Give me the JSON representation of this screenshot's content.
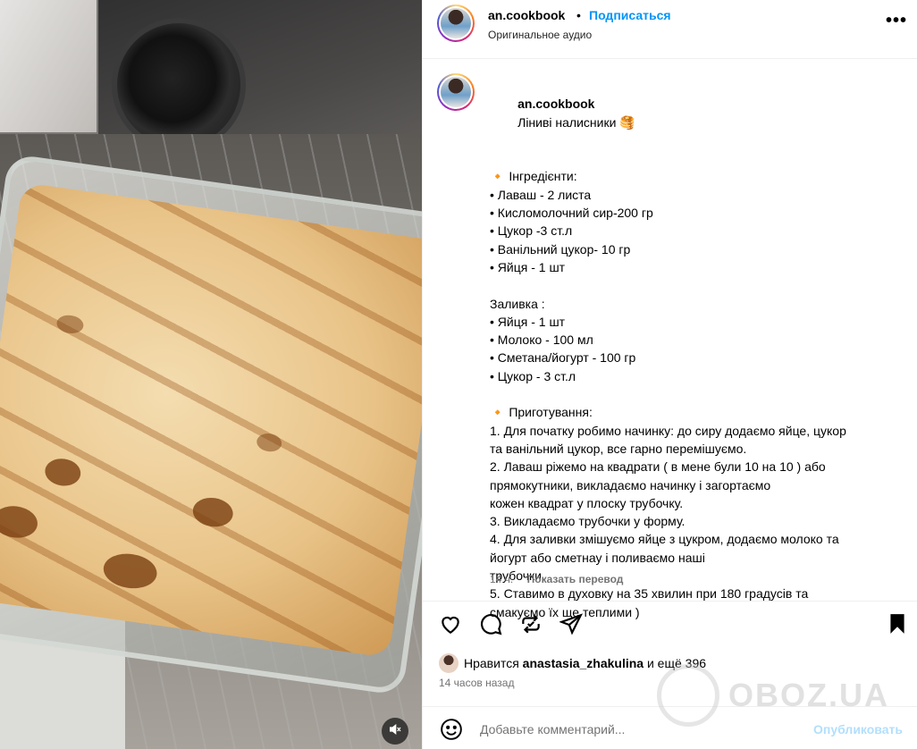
{
  "post": {
    "username": "an.cookbook",
    "separator": "•",
    "follow_label": "Подписаться",
    "audio": "Оригинальное аудио",
    "more_label": "•••"
  },
  "caption": {
    "username": "an.cookbook",
    "title": "Ліниві налисники 🥞",
    "lines": [
      "",
      "🔸 Інгредієнти:",
      "• Лаваш - 2 листа",
      "• Кисломолочний сир-200 гр",
      "• Цукор -3 ст.л",
      "• Ванільний цукор- 10 гр",
      "• Яйця - 1 шт",
      "",
      "Заливка :",
      "• Яйця - 1 шт",
      "• Молоко - 100 мл",
      "• Сметана/йогурт - 100 гр",
      "• Цукор - 3 ст.л",
      "",
      "🔸 Приготування:",
      "1. Для початку робимо начинку: до сиру додаємо яйце, цукор",
      "та ванільний цукор, все гарно перемішуємо.",
      "2. Лаваш ріжемо на квадрати ( в мене були 10 на 10 ) або",
      "прямокутники, викладаємо начинку і загортаємо",
      "кожен квадрат у плоску трубочку.",
      "3. Викладаємо трубочки у форму.",
      "4. Для заливки змішуємо яйце з цукром, додаємо молоко та",
      "йогурт або сметнау і поливаємо наші",
      "трубочки.",
      "5. Ставимо в духовку на 35 хвилин при 180 градусів та",
      "смакуємо їх ще теплими )"
    ],
    "age": "14 ч.",
    "translate_label": "Показать перевод"
  },
  "actions": {
    "like_icon": "heart-icon",
    "comment_icon": "comment-icon",
    "repost_icon": "repost-icon",
    "share_icon": "share-icon",
    "save_icon": "bookmark-icon"
  },
  "likes": {
    "prefix": "Нравится",
    "user": "anastasia_zhakulina",
    "suffix": "и ещё 396"
  },
  "time_ago": "14 часов назад",
  "comment_box": {
    "placeholder": "Добавьте комментарий...",
    "post_label": "Опубликовать"
  },
  "watermark": "OBOZ.UA",
  "colors": {
    "link_blue": "#0095f6",
    "muted": "#737373",
    "post_disabled": "#b2dffc"
  }
}
